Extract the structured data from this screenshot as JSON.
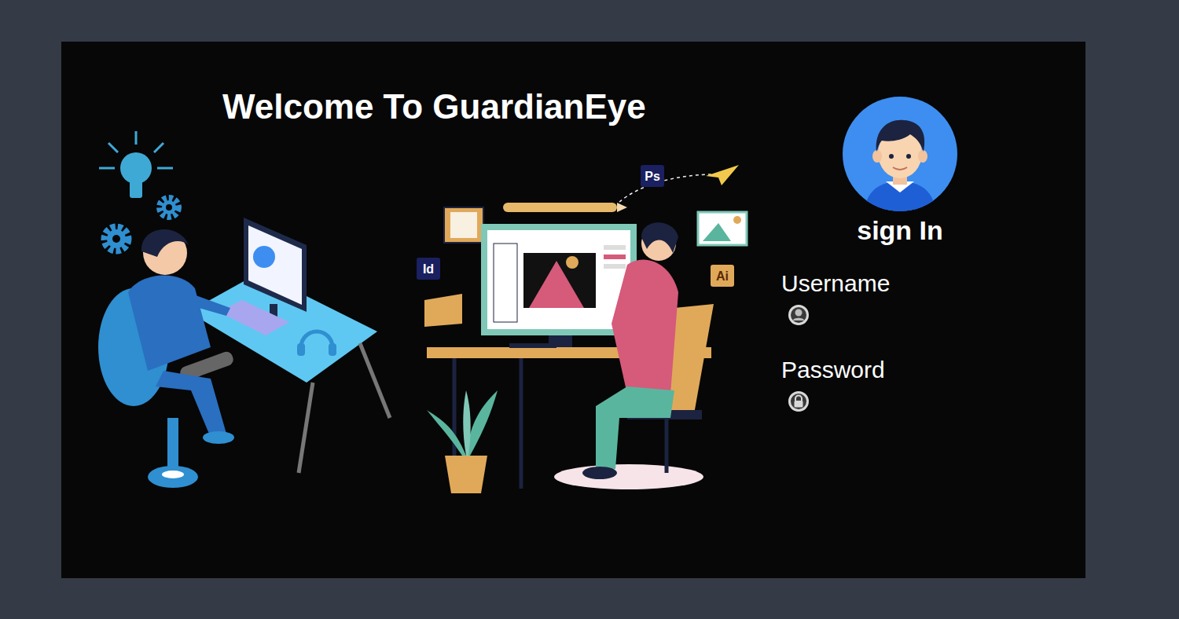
{
  "title": "Welcome To GuardianEye",
  "illustration": {
    "badges": [
      "Ps",
      "Id",
      "Ai"
    ]
  },
  "signin": {
    "heading": "sign In",
    "fields": [
      {
        "label": "Username",
        "kind": "text"
      },
      {
        "label": "Password",
        "kind": "password"
      }
    ]
  }
}
